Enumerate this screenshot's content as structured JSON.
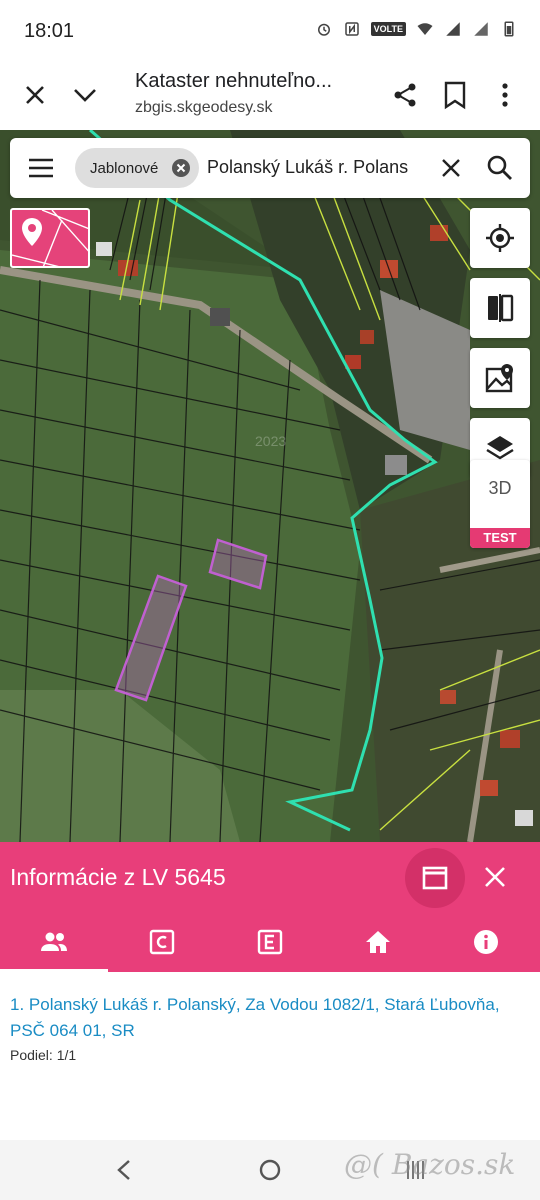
{
  "status_bar": {
    "time": "18:01",
    "volte": "VOLTE"
  },
  "browser": {
    "title": "Kataster nehnuteľno...",
    "url": "zbgis.skgeodesy.sk"
  },
  "map": {
    "search_chip": "Jablonové",
    "search_text": "Polanský Lukáš r. Polans",
    "watermark_year": "2023",
    "btn_3d_label": "3D",
    "btn_3d_badge": "TEST"
  },
  "info_panel": {
    "title": "Informácie z LV 5645",
    "owner": "1. Polanský Lukáš r. Polanský, Za Vodou 1082/1, Stará Ľubovňa, PSČ 064 01, SR",
    "share": "Podiel: 1/1"
  },
  "watermark": "@( Bazos.sk",
  "colors": {
    "accent": "#e83e7a",
    "link": "#1a8cc4",
    "boundary": "#2fe0b0",
    "parcel": "#c060d0"
  }
}
